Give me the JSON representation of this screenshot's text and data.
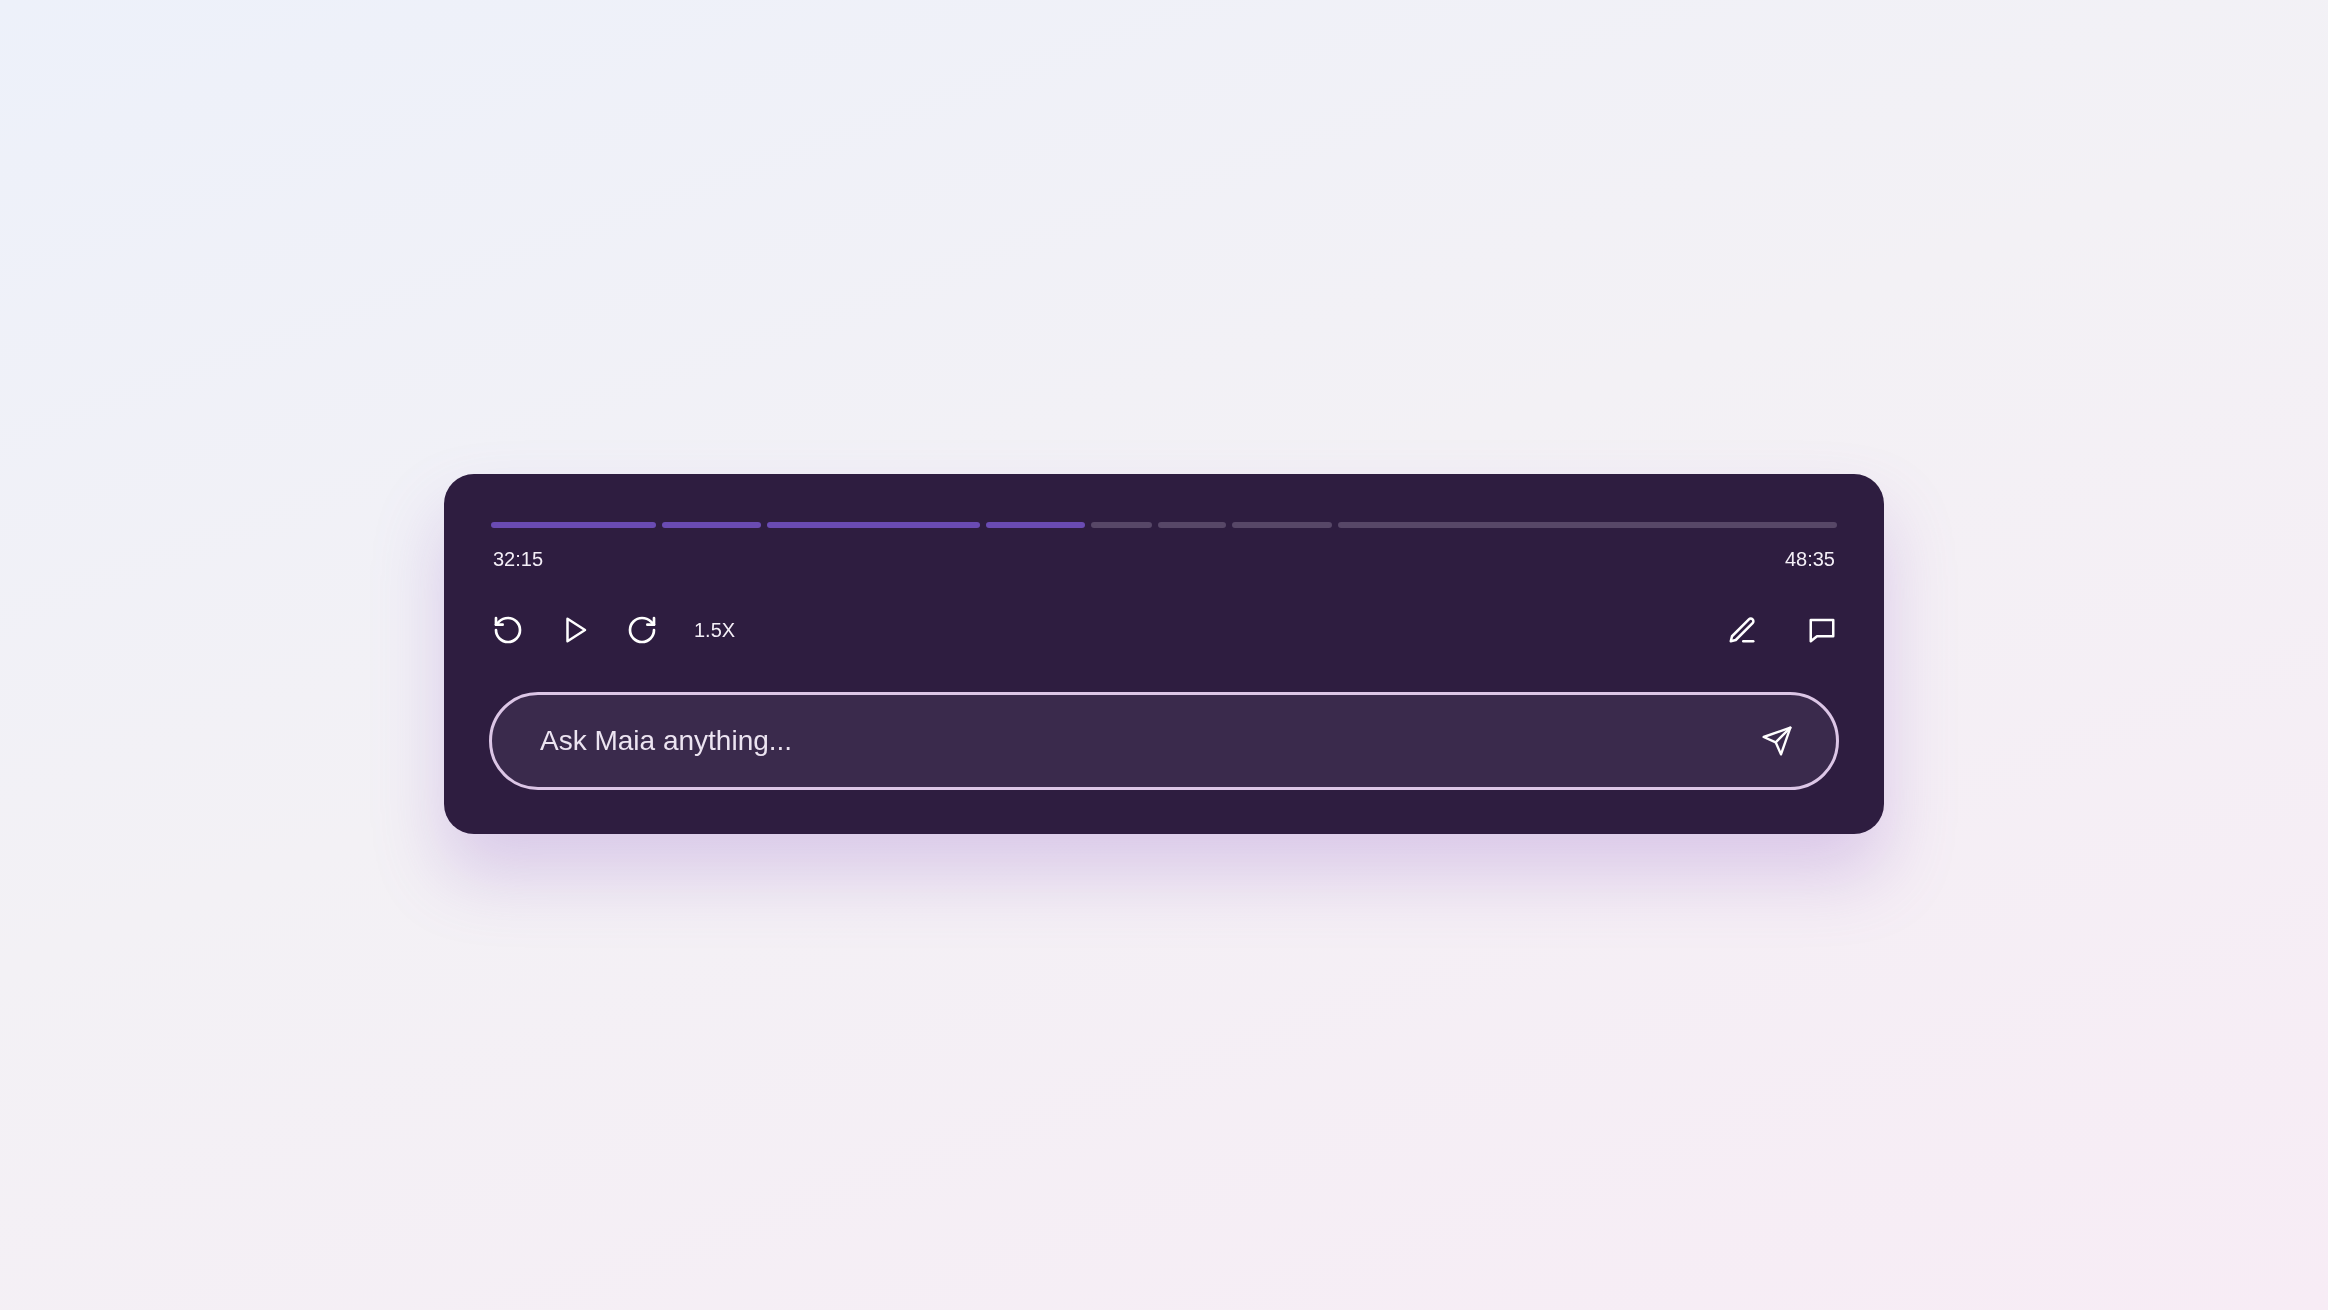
{
  "progress": {
    "segments": [
      {
        "played": true
      },
      {
        "played": true
      },
      {
        "played": true
      },
      {
        "played": true
      },
      {
        "played": false
      },
      {
        "played": false
      },
      {
        "played": false
      },
      {
        "played": false
      }
    ]
  },
  "elapsed": "32:15",
  "duration": "48:35",
  "speed": "1.5X",
  "ask": {
    "placeholder": "Ask Maia anything..."
  }
}
